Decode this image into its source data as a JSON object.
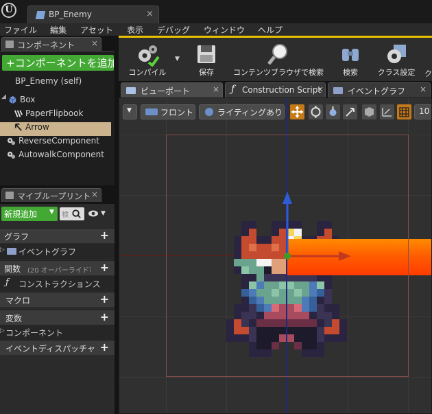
{
  "window": {
    "tab_title": "BP_Enemy",
    "tab_close": "×"
  },
  "menu": [
    "ファイル",
    "編集",
    "アセット",
    "表示",
    "デバッグ",
    "ウィンドウ",
    "ヘルプ"
  ],
  "components_panel": {
    "tab_label": "コンポーネント",
    "tab_close": "×",
    "add_button": "+コンポーネントを追加",
    "items": [
      "BP_Enemy (self)",
      "Box",
      "PaperFlipbook",
      "Arrow",
      "ReverseComponent",
      "AutowalkComponent"
    ],
    "selected": "Arrow"
  },
  "my_blueprint_panel": {
    "tab_label": "マイブループリント",
    "tab_close": "×",
    "new_button": "新規追加",
    "search_placeholder": "検",
    "sections": {
      "graph": "グラフ",
      "event_graph": "イベントグラフ",
      "functions": "関数",
      "functions_override": "(20 オーバーライド可",
      "construction": "コンストラクションス",
      "macro": "マクロ",
      "variables": "変数",
      "components": "コンポーネント",
      "dispatchers": "イベントディスパッチャー"
    }
  },
  "toolbar": {
    "compile": "コンパイル",
    "save": "保存",
    "content_browser": "コンテンツブラウザで検索",
    "search": "検索",
    "class_settings": "クラス設定"
  },
  "editor_tabs": [
    {
      "label": "ビューポート",
      "active": true
    },
    {
      "label": "Construction Script",
      "active": false
    },
    {
      "label": "イベントグラフ",
      "active": false
    }
  ],
  "viewport": {
    "view_mode": "フロント",
    "lighting": "ライティングあり",
    "grid_snap": "10"
  },
  "colors": {
    "accent_green": "#43a834",
    "selection": "#cbb38e",
    "toolbar_accent": "#e8c200",
    "highlight_orange": "#c57a1a"
  }
}
